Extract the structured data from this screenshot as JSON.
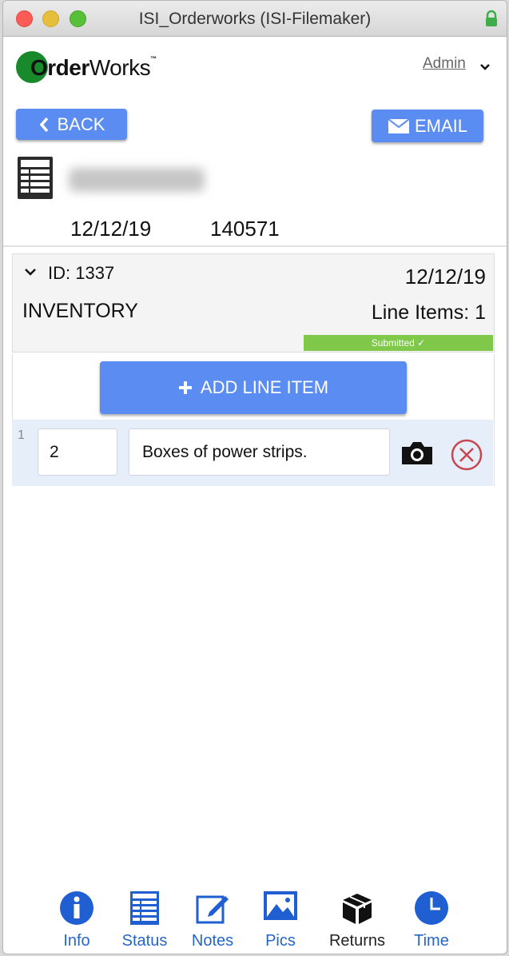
{
  "window": {
    "title": "ISI_Orderworks (ISI-Filemaker)"
  },
  "logo": {
    "first": "O",
    "rest": "rder",
    "second": "Works",
    "tm": "™"
  },
  "header": {
    "user": "Admin",
    "back_label": "BACK",
    "email_label": "EMAIL",
    "date": "12/12/19",
    "number": "140571"
  },
  "order": {
    "id_label": "ID: 1337",
    "date": "12/12/19",
    "type": "INVENTORY",
    "line_items_label": "Line Items: 1",
    "status": "Submitted ✓"
  },
  "add_line_item_label": "ADD LINE ITEM",
  "line_items": [
    {
      "index": "1",
      "qty": "2",
      "description": "Boxes of power strips."
    }
  ],
  "tabs": [
    {
      "label": "Info",
      "icon": "info-icon"
    },
    {
      "label": "Status",
      "icon": "table-icon"
    },
    {
      "label": "Notes",
      "icon": "edit-icon"
    },
    {
      "label": "Pics",
      "icon": "picture-icon"
    },
    {
      "label": "Returns",
      "icon": "box-icon"
    },
    {
      "label": "Time",
      "icon": "clock-icon"
    }
  ],
  "colors": {
    "accent": "#5b8cf2",
    "tab_blue": "#1f5fd1",
    "badge_green": "#7fc84a",
    "logo_green": "#198a2c",
    "delete_red": "#c8474f"
  }
}
